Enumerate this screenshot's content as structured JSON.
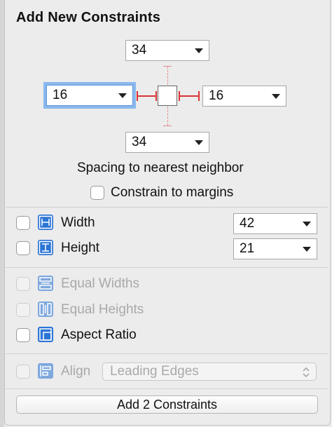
{
  "title": "Add New Constraints",
  "spacing": {
    "top": "34",
    "left": "16",
    "right": "16",
    "bottom": "34",
    "caption": "Spacing to nearest neighbor"
  },
  "constrain_margins": {
    "label": "Constrain to margins",
    "checked": false
  },
  "size": [
    {
      "label": "Width",
      "value": "42",
      "enabled": true,
      "checked": false
    },
    {
      "label": "Height",
      "value": "21",
      "enabled": true,
      "checked": false
    }
  ],
  "equal": [
    {
      "label": "Equal Widths",
      "enabled": false
    },
    {
      "label": "Equal Heights",
      "enabled": false
    },
    {
      "label": "Aspect Ratio",
      "enabled": true
    }
  ],
  "align": {
    "label": "Align",
    "selected": "Leading Edges",
    "enabled": false
  },
  "add_button": "Add 2 Constraints",
  "colors": {
    "accent": "#2c75d6",
    "spacing_line": "#dd3333",
    "focus_ring": "#8ab8ee"
  }
}
